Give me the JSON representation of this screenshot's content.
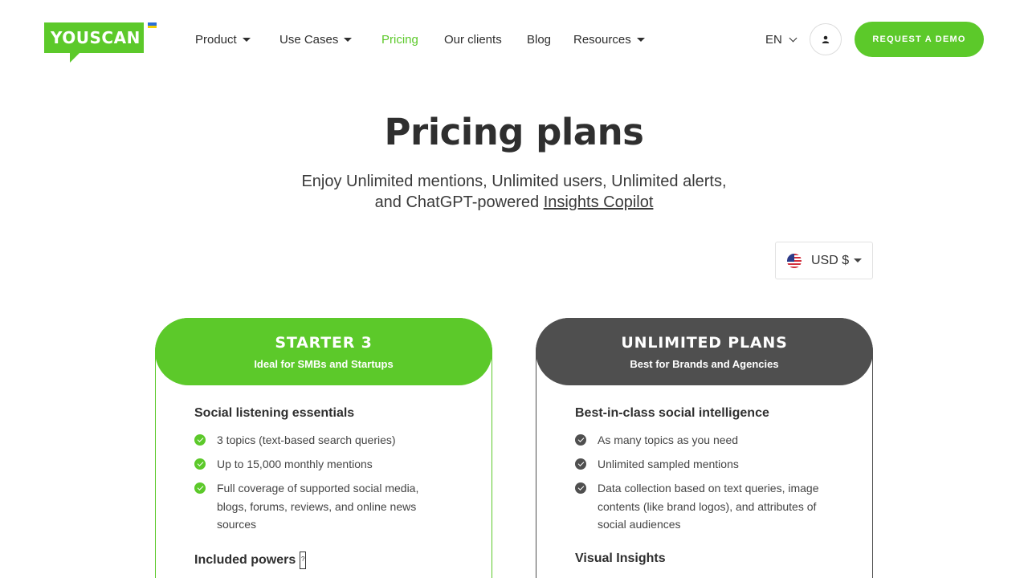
{
  "header": {
    "logo_text": "YOUSCAN",
    "nav": [
      {
        "label": "Product",
        "has_dropdown": true
      },
      {
        "label": "Use Cases",
        "has_dropdown": true
      },
      {
        "label": "Pricing",
        "active": true
      },
      {
        "label": "Our clients"
      },
      {
        "label": "Blog"
      },
      {
        "label": "Resources",
        "has_dropdown": true
      }
    ],
    "language": "EN",
    "cta": "REQUEST A DEMO"
  },
  "hero": {
    "title": "Pricing plans",
    "subtitle_line1": "Enjoy Unlimited mentions, Unlimited users, Unlimited alerts,",
    "subtitle_line2_prefix": "and ChatGPT-powered ",
    "subtitle_link": "Insights Copilot"
  },
  "currency": {
    "selected": "USD $",
    "flag_icon": "us-flag-icon"
  },
  "plans": [
    {
      "name": "STARTER 3",
      "tagline": "Ideal for SMBs and Startups",
      "section_title": "Social listening essentials",
      "features": [
        "3 topics (text-based search queries)",
        "Up to 15,000 monthly mentions",
        "Full coverage of supported social media, blogs, forums, reviews, and online news sources"
      ],
      "next_section": "Included powers",
      "next_section_help": "?"
    },
    {
      "name": "UNLIMITED PLANS",
      "tagline": "Best for Brands and Agencies",
      "section_title": "Best-in-class social intelligence",
      "features": [
        "As many topics as you need",
        "Unlimited sampled mentions",
        "Data collection based on text queries, image contents (like brand logos), and attributes of social audiences"
      ],
      "next_section": "Visual Insights"
    }
  ],
  "colors": {
    "brand_green": "#5cc92a",
    "dark_gray": "#4f4f4f",
    "text": "#2f2f2f"
  }
}
